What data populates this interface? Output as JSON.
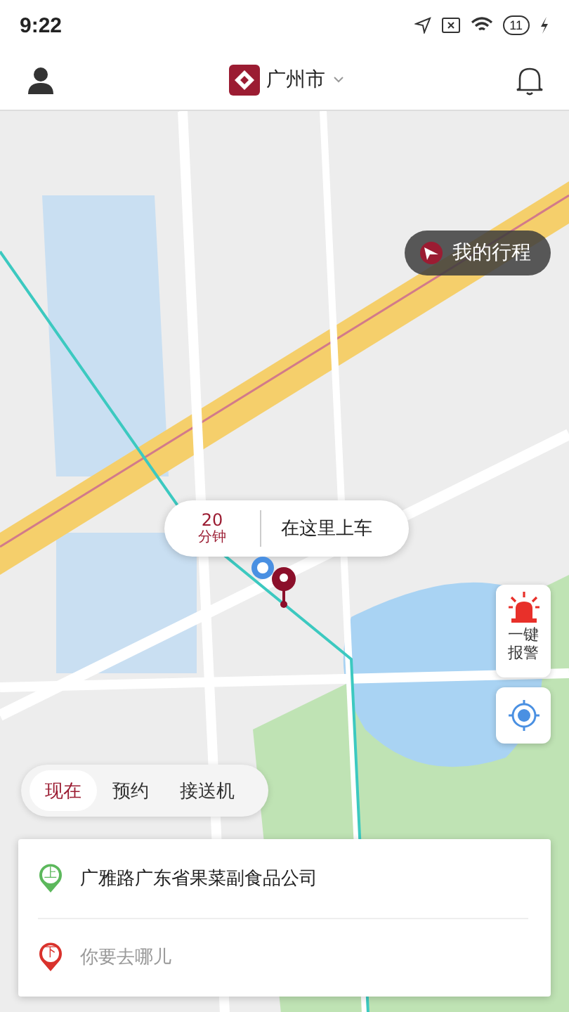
{
  "status_bar": {
    "time": "9:22",
    "battery": "11"
  },
  "header": {
    "city": "广州市"
  },
  "trip_button": {
    "label": "我的行程"
  },
  "pickup_bubble": {
    "eta_value": "20",
    "eta_unit": "分钟",
    "label": "在这里上车"
  },
  "alarm_button": {
    "label": "一键报警"
  },
  "ride_tabs": [
    {
      "label": "现在",
      "selected": true
    },
    {
      "label": "预约",
      "selected": false
    },
    {
      "label": "接送机",
      "selected": false
    }
  ],
  "route": {
    "pickup": {
      "badge": "上",
      "value": "广雅路广东省果菜副食品公司"
    },
    "dropoff": {
      "badge": "下",
      "placeholder": "你要去哪儿"
    }
  }
}
